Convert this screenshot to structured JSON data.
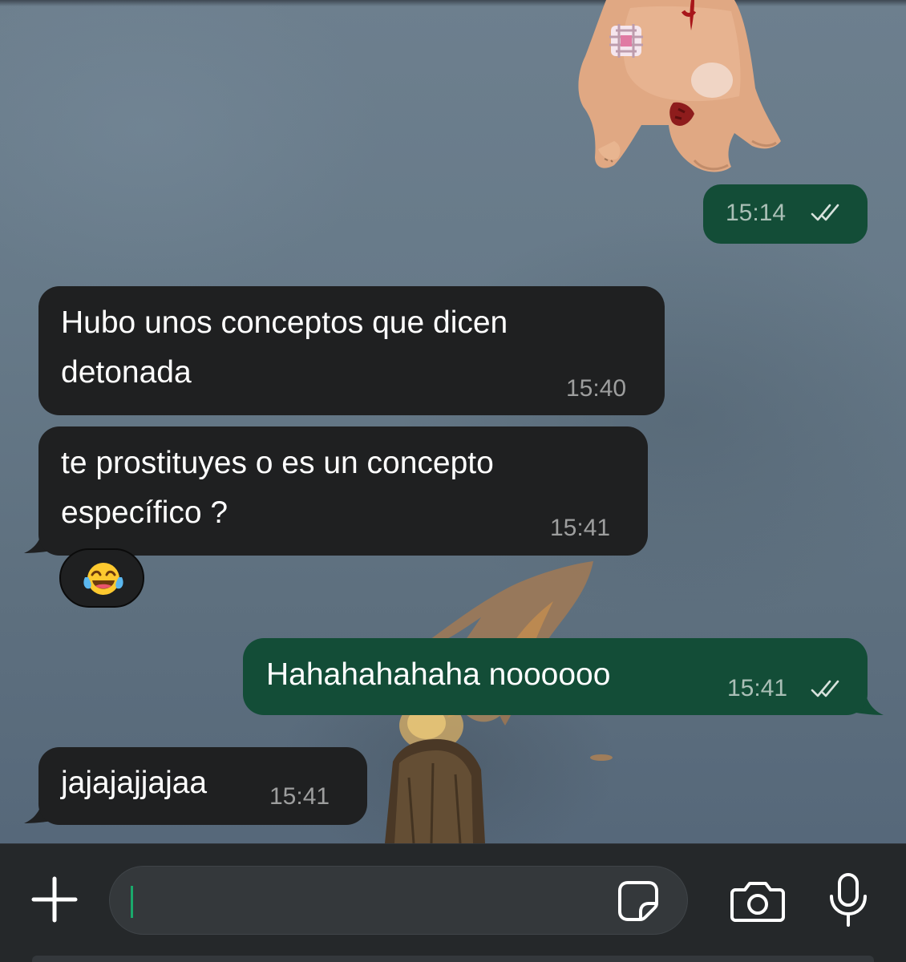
{
  "messages": [
    {
      "id": "m1",
      "direction": "outgoing",
      "type": "sticker",
      "time": "15:14",
      "status": "read"
    },
    {
      "id": "m2",
      "direction": "incoming",
      "lines": [
        "Hubo unos conceptos que dicen",
        "detonada"
      ],
      "time": "15:40"
    },
    {
      "id": "m3",
      "direction": "incoming",
      "lines": [
        "te prostituyes o es un concepto",
        "específico ?"
      ],
      "time": "15:41",
      "reaction": "face-with-tears-of-joy"
    },
    {
      "id": "m4",
      "direction": "outgoing",
      "lines": [
        "Hahahahahaha noooooo"
      ],
      "time": "15:41",
      "status": "read"
    },
    {
      "id": "m5",
      "direction": "incoming",
      "lines": [
        "jajajajjajaa"
      ],
      "time": "15:41"
    }
  ],
  "composer": {
    "value": "",
    "icons": [
      "plus-icon",
      "sticker-icon",
      "camera-icon",
      "microphone-icon"
    ]
  },
  "colors": {
    "incoming_bubble": "#1f2021",
    "outgoing_bubble": "#134d37",
    "input_bar": "#25282a",
    "caret": "#1aa96b",
    "wallpaper": "#677a89"
  }
}
